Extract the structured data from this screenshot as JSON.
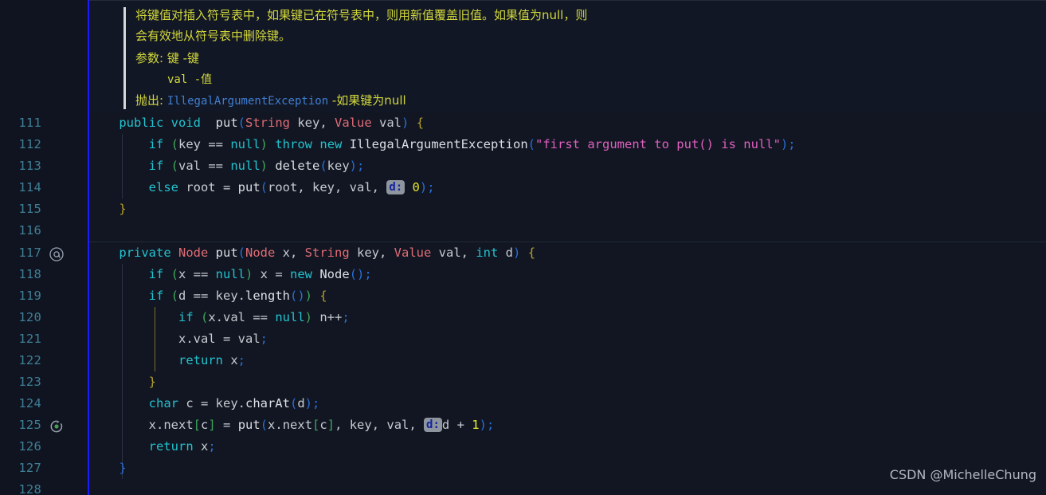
{
  "doc": {
    "lines": [
      "将键值对插入符号表中，如果键已在符号表中，则用新值覆盖旧值。如果值为null，则",
      "会有效地从符号表中删除键。"
    ],
    "params_label": "参数: ",
    "param1": "键 -键",
    "param2": "val -值",
    "throws_label": "抛出: ",
    "throws_type": "IllegalArgumentException",
    "throws_desc": " -如果键为null"
  },
  "gutter": {
    "line_numbers": [
      "111",
      "112",
      "113",
      "114",
      "115",
      "116",
      "117",
      "118",
      "119",
      "120",
      "121",
      "122",
      "123",
      "124",
      "125",
      "126",
      "127",
      "128"
    ],
    "icons": [
      {
        "line": "117",
        "glyph": "@",
        "name": "override-method-icon"
      },
      {
        "line": "125",
        "glyph": "↺",
        "name": "recursive-call-icon"
      }
    ]
  },
  "code": {
    "lines": [
      {
        "num": "111",
        "text": "    public void put(String key, Value val) {"
      },
      {
        "num": "112",
        "text": "        if (key == null) throw new IllegalArgumentException(\"first argument to put() is null\");"
      },
      {
        "num": "113",
        "text": "        if (val == null) delete(key);"
      },
      {
        "num": "114",
        "text": "        else root = put(root, key, val, d: 0);"
      },
      {
        "num": "115",
        "text": "    }"
      },
      {
        "num": "116",
        "text": ""
      },
      {
        "num": "117",
        "text": "    private Node put(Node x, String key, Value val, int d) {"
      },
      {
        "num": "118",
        "text": "        if (x == null) x = new Node();"
      },
      {
        "num": "119",
        "text": "        if (d == key.length()) {"
      },
      {
        "num": "120",
        "text": "            if (x.val == null) n++;"
      },
      {
        "num": "121",
        "text": "            x.val = val;"
      },
      {
        "num": "122",
        "text": "            return x;"
      },
      {
        "num": "123",
        "text": "        }"
      },
      {
        "num": "124",
        "text": "        char c = key.charAt(d);"
      },
      {
        "num": "125",
        "text": "        x.next[c] = put(x.next[c], key, val, d: d + 1);"
      },
      {
        "num": "126",
        "text": "        return x;"
      },
      {
        "num": "127",
        "text": "    }"
      },
      {
        "num": "128",
        "text": ""
      }
    ],
    "inlay_hints": [
      {
        "line": "114",
        "label": "d:"
      },
      {
        "line": "125",
        "label": "d:"
      }
    ]
  },
  "watermark": {
    "text": "CSDN @MichelleChung"
  },
  "colors": {
    "background": "#111622",
    "gutter_background": "#0f1420",
    "gutter_border": "#1a1aff",
    "line_number": "#3f7f96",
    "doc_text": "#d2d83a",
    "doc_type_link": "#3f7fd0",
    "keyword": "#22c3cf",
    "type": "#e06c75",
    "string": "#e060c0",
    "number": "#e8e82e",
    "hint_background": "#8e959e",
    "hint_text": "#12239e"
  }
}
